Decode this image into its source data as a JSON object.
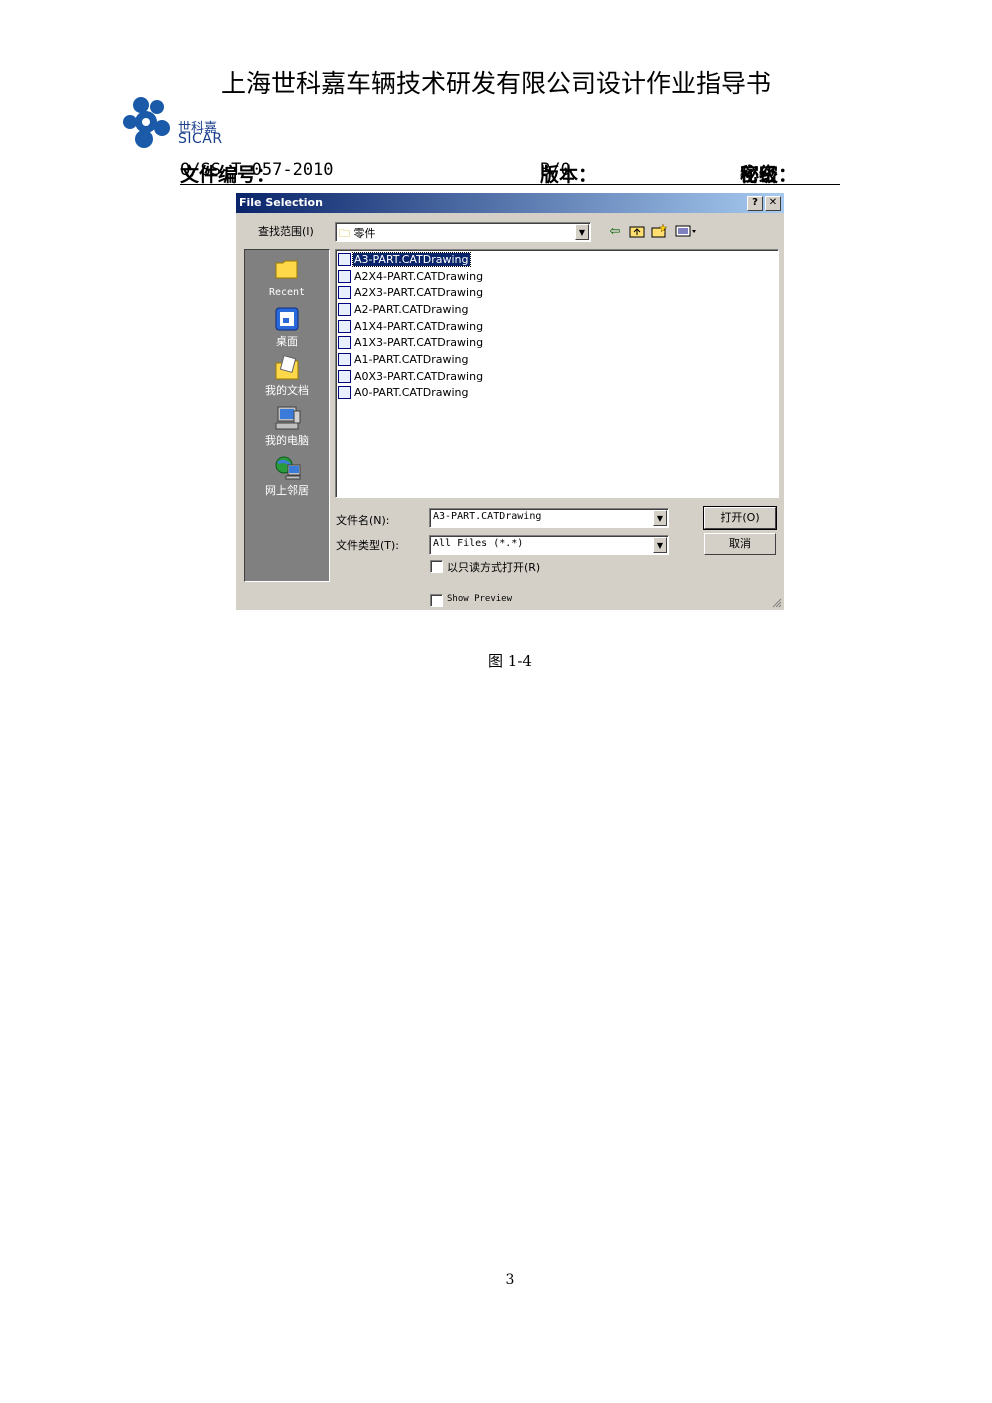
{
  "document": {
    "title": "上海世科嘉车辆技术研发有限公司设计作业指导书",
    "logo_cn": "世科嘉",
    "logo_en": "SICAR",
    "doc_no_label": "文件编号：",
    "doc_no": "Q/SS-T-057-2010",
    "version_label": "版本：",
    "version": "B/0",
    "secrecy_label": "密级：",
    "secrecy": "秘密",
    "caption": "图 1-4",
    "page_number": "3"
  },
  "dialog": {
    "title": "File Selection",
    "help_button": "?",
    "close_button": "✕",
    "look_in_label": "查找范围(I)",
    "look_in_value": "零件",
    "toolbar_icons": [
      "back-icon",
      "up-folder-icon",
      "new-folder-icon",
      "view-menu-icon"
    ],
    "places": [
      {
        "label": "Recent",
        "icon": "recent-folder-icon"
      },
      {
        "label": "桌面",
        "icon": "desktop-icon"
      },
      {
        "label": "我的文档",
        "icon": "my-documents-icon"
      },
      {
        "label": "我的电脑",
        "icon": "my-computer-icon"
      },
      {
        "label": "网上邻居",
        "icon": "network-icon"
      }
    ],
    "files": [
      "A3-PART.CATDrawing",
      "A2X4-PART.CATDrawing",
      "A2X3-PART.CATDrawing",
      "A2-PART.CATDrawing",
      "A1X4-PART.CATDrawing",
      "A1X3-PART.CATDrawing",
      "A1-PART.CATDrawing",
      "A0X3-PART.CATDrawing",
      "A0-PART.CATDrawing"
    ],
    "selected_file": "A3-PART.CATDrawing",
    "filename_label": "文件名(N):",
    "filename_value": "A3-PART.CATDrawing",
    "filetype_label": "文件类型(T):",
    "filetype_value": "All Files (*.*)",
    "open_button": "打开(O)",
    "cancel_button": "取消",
    "readonly_label": "以只读方式打开(R)",
    "show_preview_label": "Show Preview"
  }
}
